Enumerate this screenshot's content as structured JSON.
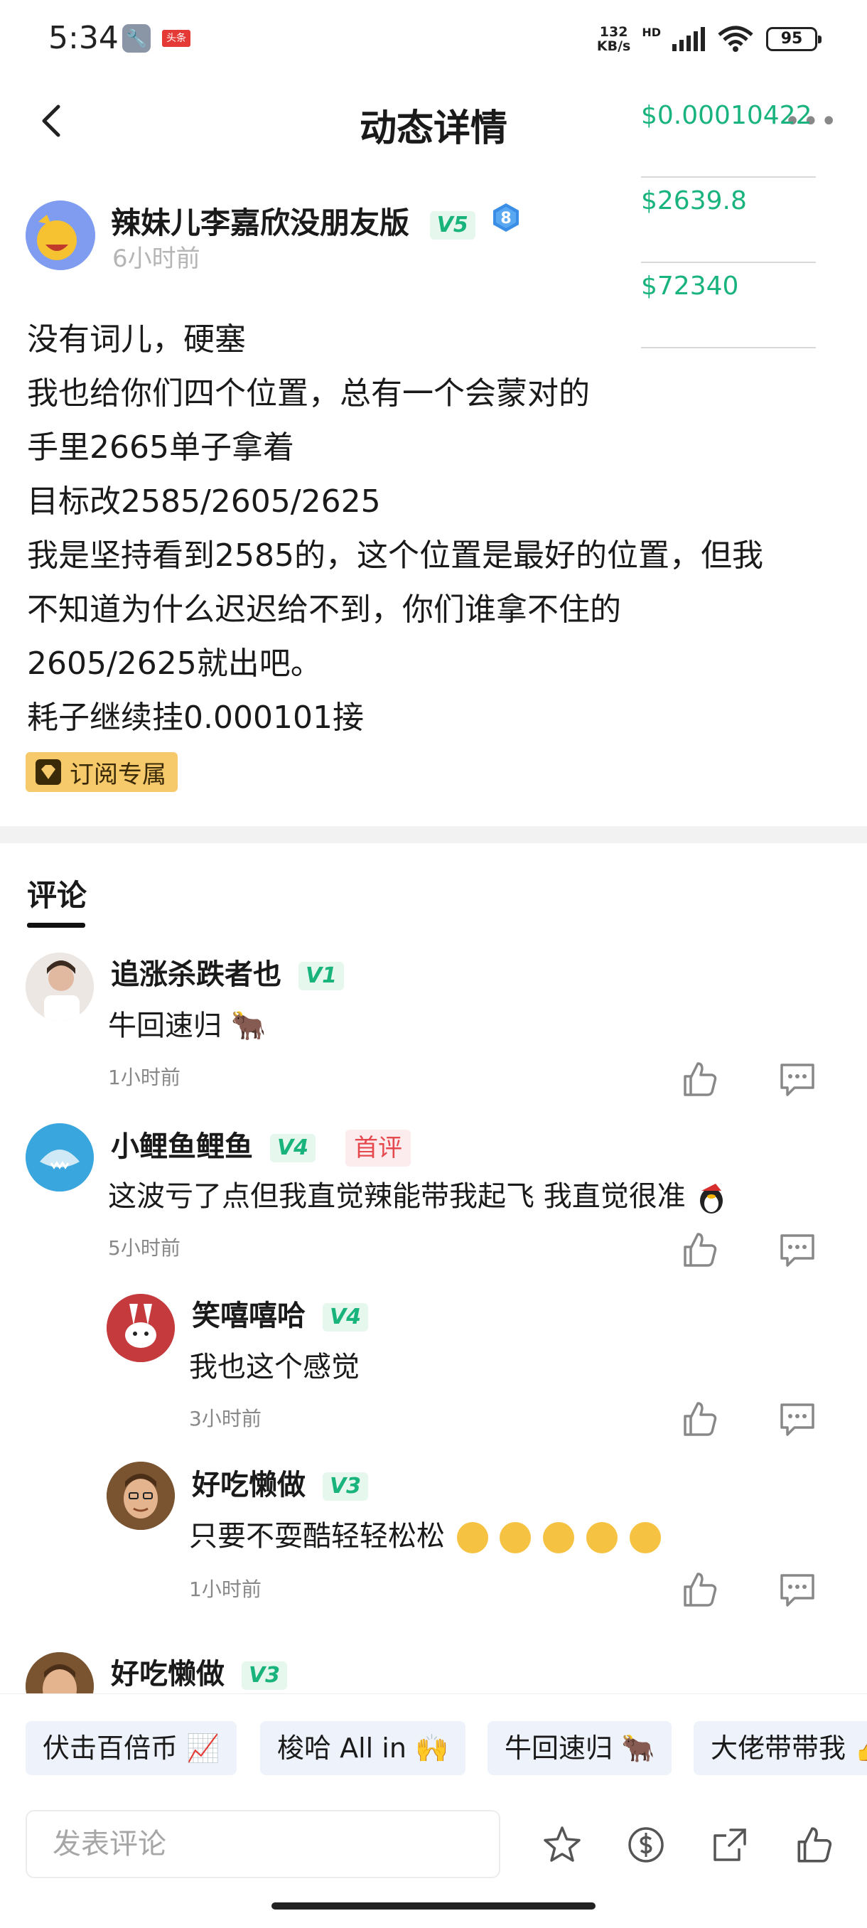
{
  "status_bar": {
    "time": "5:34",
    "net_speed_value": "132",
    "net_speed_unit": "KB/s",
    "hd": "HD",
    "wifi_sub": "6",
    "battery": "95",
    "app_badge": "头条"
  },
  "nav": {
    "title": "动态详情",
    "more": "•••"
  },
  "ticker": [
    "$0.00010422",
    "$2639.8",
    "$72340"
  ],
  "post": {
    "author": "辣妹儿李嘉欣没朋友版",
    "vip": "V5",
    "level": "8",
    "time": "6小时前",
    "lines": [
      "没有词儿，硬塞",
      "我也给你们四个位置，总有一个会蒙对的",
      "手里2665单子拿着",
      "目标改2585/2605/2625",
      "我是坚持看到2585的，这个位置是最好的位置，但我",
      "不知道为什么迟迟给不到，你们谁拿不住的",
      "2605/2625就出吧。",
      "耗子继续挂0.000101接"
    ],
    "subscribe_tag": "订阅专属"
  },
  "comments_tab": "评论",
  "comments": [
    {
      "name": "追涨杀跌者也",
      "vip": "V1",
      "text": "牛回速归 🐂",
      "time": "1小时前"
    },
    {
      "name": "小鲤鱼鲤鱼",
      "vip": "V4",
      "first": "首评",
      "text": "这波亏了点但我直觉辣能带我起飞 我直觉很准",
      "time": "5小时前"
    },
    {
      "name": "笑嘻嘻哈",
      "vip": "V4",
      "text": "我也这个感觉",
      "time": "3小时前"
    },
    {
      "name": "好吃懒做",
      "vip": "V3",
      "text": "只要不耍酷轻轻松松",
      "time": "1小时前"
    },
    {
      "name": "好吃懒做",
      "vip": "V3"
    }
  ],
  "quick_replies": [
    "伏击百倍币 📈",
    "梭哈 All in 🙌",
    "牛回速归 🐂",
    "大佬带带我 👍"
  ],
  "input_placeholder": "发表评论",
  "colors": {
    "accent": "#19b37d",
    "first_tag": "#e5484d",
    "subscribe_bg": "#f6c96a"
  }
}
